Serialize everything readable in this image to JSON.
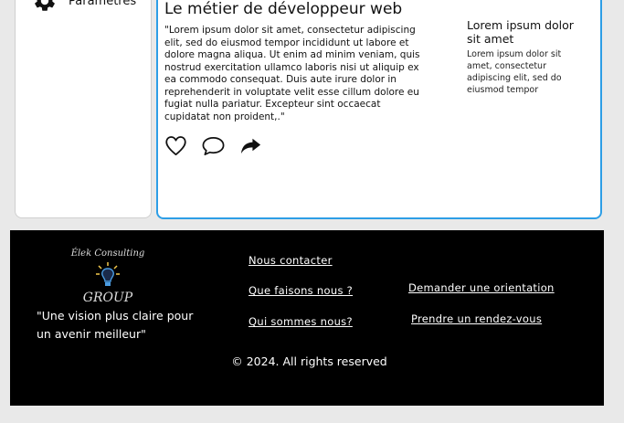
{
  "sidebar": {
    "item_label": "Paramètres",
    "item_icon": "gear-icon"
  },
  "article": {
    "title": "Le métier de développeur web",
    "body": "\"Lorem ipsum dolor sit amet, consectetur adipiscing elit, sed do eiusmod tempor incididunt ut labore et dolore magna aliqua. Ut enim ad minim veniam, quis nostrud exercitation ullamco laboris nisi ut aliquip ex ea commodo consequat. Duis aute irure dolor in reprehenderit in voluptate velit esse cillum dolore eu fugiat nulla pariatur. Excepteur sint occaecat cupidatat non proident,.\"",
    "aside_title": "Lorem ipsum dolor sit amet",
    "aside_body": "Lorem ipsum dolor sit amet, consectetur adipiscing elit, sed do eiusmod tempor",
    "actions": [
      "heart-icon",
      "comment-icon",
      "share-icon"
    ]
  },
  "footer": {
    "logo_brand": "Élek Consulting",
    "logo_group": "GROUP",
    "tagline": "\"Une vision plus claire pour un avenir meilleur\"",
    "links": {
      "contact": "Nous contacter",
      "what": "Que faisons nous ?",
      "who": "Qui sommes nous?",
      "orientation": "Demander une orientation",
      "appointment": "Prendre un rendez-vous"
    },
    "copyright": "© 2024. All rights reserved"
  },
  "colors": {
    "accent": "#2d9ee6",
    "footer_bg": "#000000",
    "page_bg": "#e9e9e9"
  }
}
